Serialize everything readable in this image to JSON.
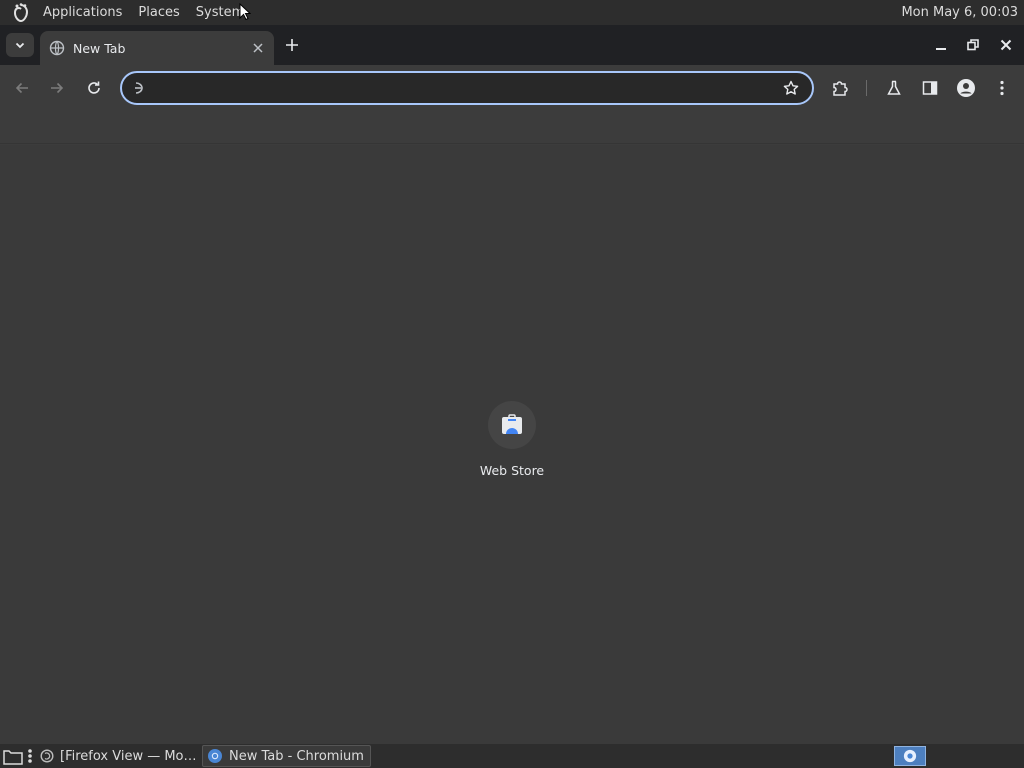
{
  "top_panel": {
    "menus": [
      "Applications",
      "Places",
      "System"
    ],
    "clock": "Mon May  6, 00:03"
  },
  "browser": {
    "tab": {
      "title": "New Tab",
      "favicon": "globe-icon"
    },
    "omnibox": {
      "value": "",
      "placeholder": ""
    },
    "toolbar_icons": [
      "back-icon",
      "forward-icon",
      "reload-icon",
      "star-icon",
      "extensions-icon",
      "labs-icon",
      "side-panel-icon",
      "profile-icon",
      "menu-icon"
    ],
    "accent": "#a8c7fa"
  },
  "ntp": {
    "shortcut": {
      "label": "Web Store",
      "icon": "web-store-icon"
    }
  },
  "taskbar": {
    "tasks": [
      {
        "label": "[Firefox View — Mo…",
        "icon": "firefox-icon"
      },
      {
        "label": "New Tab - Chromium",
        "icon": "chromium-icon"
      }
    ]
  }
}
